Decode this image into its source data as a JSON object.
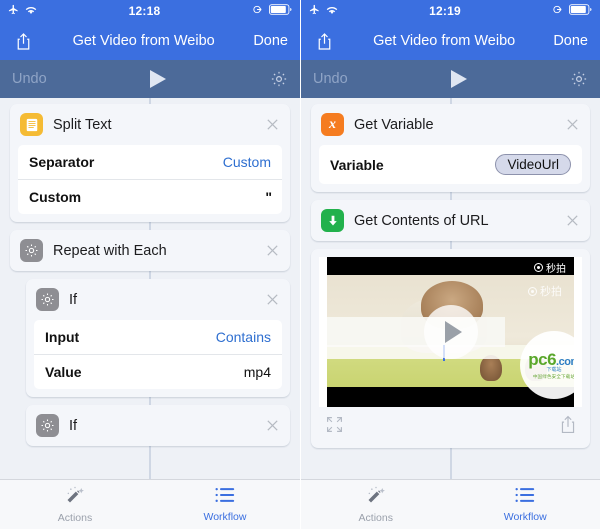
{
  "screens": [
    {
      "id": "left",
      "statusbar": {
        "airplane_icon": "airplane-icon",
        "wifi_icon": "wifi-icon",
        "time": "12:18",
        "rotation_lock_icon": "rotation-lock-icon",
        "battery_icon": "battery-icon"
      },
      "navbar": {
        "share_icon": "share-icon",
        "title": "Get Video from Weibo",
        "done_label": "Done"
      },
      "toolbar": {
        "undo_label": "Undo",
        "play_icon": "play-icon",
        "settings_icon": "gear-icon"
      },
      "cards": [
        {
          "title": "Split Text",
          "icon": "document-lines-icon",
          "icon_color": "#f5bb34",
          "indent": false,
          "params": [
            {
              "label": "Separator",
              "value": "Custom",
              "style": "link"
            },
            {
              "label": "Custom",
              "value": "\"",
              "style": "quote"
            }
          ]
        },
        {
          "title": "Repeat with Each",
          "icon": "gear-icon",
          "icon_color": "#8e8e93",
          "indent": false,
          "params": []
        },
        {
          "title": "If",
          "icon": "gear-icon",
          "icon_color": "#8e8e93",
          "indent": true,
          "params": [
            {
              "label": "Input",
              "value": "Contains",
              "style": "link"
            },
            {
              "label": "Value",
              "value": "mp4",
              "style": "plain"
            }
          ]
        },
        {
          "title": "If",
          "icon": "gear-icon",
          "icon_color": "#8e8e93",
          "indent": true,
          "params": []
        }
      ],
      "video": null,
      "tabs": [
        {
          "label": "Actions",
          "icon": "magic-wand-icon",
          "active": false
        },
        {
          "label": "Workflow",
          "icon": "list-icon",
          "active": true
        }
      ]
    },
    {
      "id": "right",
      "statusbar": {
        "airplane_icon": "airplane-icon",
        "wifi_icon": "wifi-icon",
        "time": "12:19",
        "rotation_lock_icon": "rotation-lock-icon",
        "battery_icon": "battery-icon"
      },
      "navbar": {
        "share_icon": "share-icon",
        "title": "Get Video from Weibo",
        "done_label": "Done"
      },
      "toolbar": {
        "undo_label": "Undo",
        "play_icon": "play-icon",
        "settings_icon": "gear-icon"
      },
      "cards": [
        {
          "title": "Get Variable",
          "icon": "variable-x-icon",
          "icon_color": "#f57c20",
          "indent": false,
          "params": [
            {
              "label": "Variable",
              "value": "VideoUrl",
              "style": "pill"
            }
          ]
        },
        {
          "title": "Get Contents of URL",
          "icon": "download-arrow-icon",
          "icon_color": "#22b14c",
          "indent": false,
          "params": []
        }
      ],
      "video": {
        "play_icon": "play-icon",
        "fullscreen_icon": "fullscreen-icon",
        "share_icon": "share-icon",
        "overlay_badge_1": "秒拍",
        "overlay_badge_2": "秒拍",
        "watermark": {
          "main": "pc6",
          "domain": ".com",
          "tagline": "下载站",
          "sub": "中国绿色安全下载站"
        }
      },
      "tabs": [
        {
          "label": "Actions",
          "icon": "magic-wand-icon",
          "active": false
        },
        {
          "label": "Workflow",
          "icon": "list-icon",
          "active": true
        }
      ]
    }
  ],
  "colors": {
    "nav_blue": "#3b6fe0",
    "toolbar_blue": "#4c6a99",
    "background": "#eef1f6",
    "link_blue": "#2f6fd0",
    "tab_active": "#3b6fe0"
  }
}
